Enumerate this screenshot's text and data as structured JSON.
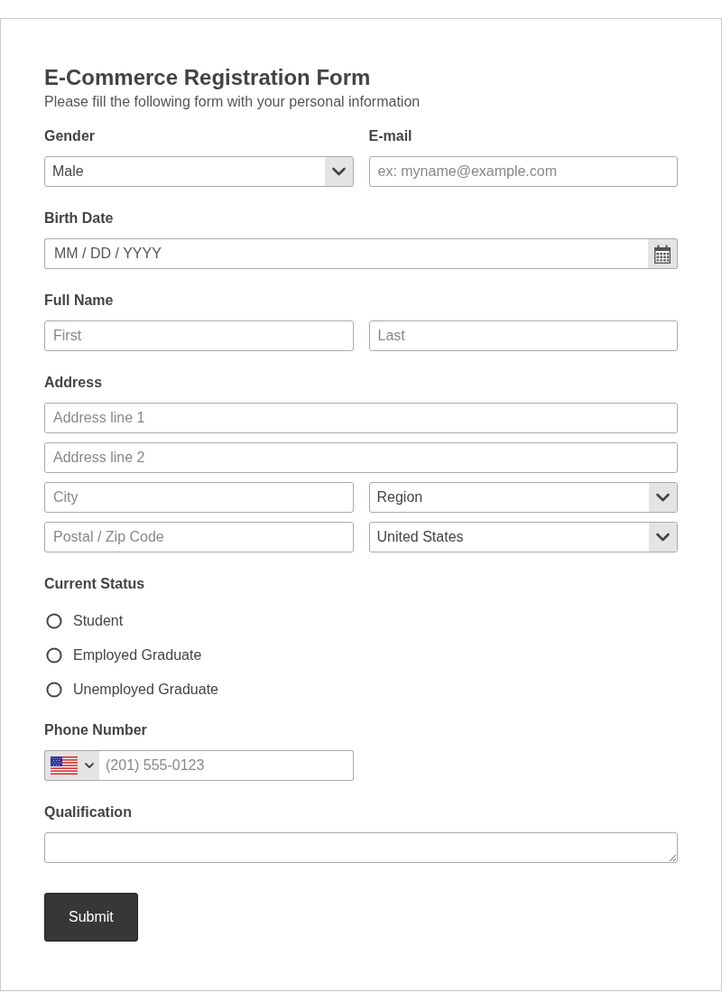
{
  "form": {
    "title": "E-Commerce Registration Form",
    "subtitle": "Please fill the following form with your personal information"
  },
  "rows": [
    [
      {
        "label": "Gender",
        "lines": [
          [
            {
              "kind": "select",
              "value": "Male"
            }
          ]
        ]
      },
      {
        "label": "E-mail",
        "lines": [
          [
            {
              "kind": "input",
              "placeholder": "ex: myname@example.com"
            }
          ]
        ]
      }
    ],
    [
      {
        "label": "Birth Date",
        "lines": [
          [
            {
              "kind": "date",
              "placeholder": "MM / DD / YYYY"
            }
          ]
        ]
      }
    ],
    [
      {
        "label": "Full Name",
        "lines": [
          [
            {
              "kind": "input",
              "placeholder": "First"
            },
            {
              "kind": "input",
              "placeholder": "Last"
            }
          ]
        ]
      }
    ],
    [
      {
        "label": "Address",
        "lines": [
          [
            {
              "kind": "input",
              "placeholder": "Address line 1"
            }
          ],
          [
            {
              "kind": "input",
              "placeholder": "Address line 2"
            }
          ],
          [
            {
              "kind": "input",
              "placeholder": "City"
            },
            {
              "kind": "select",
              "value": "Region"
            }
          ],
          [
            {
              "kind": "input",
              "placeholder": "Postal / Zip Code"
            },
            {
              "kind": "select",
              "value": "United States"
            }
          ]
        ]
      }
    ],
    [
      {
        "label": "Current Status",
        "lines": [
          [
            {
              "kind": "radio",
              "options": [
                {
                  "label": "Student",
                  "selected": false
                },
                {
                  "label": "Employed Graduate",
                  "selected": false
                },
                {
                  "label": "Unemployed Graduate",
                  "selected": false
                }
              ]
            }
          ]
        ]
      }
    ],
    [
      {
        "label": "Phone Number",
        "lines": [
          [
            {
              "kind": "phone",
              "placeholder": "(201) 555-0123"
            }
          ]
        ]
      }
    ],
    [
      {
        "label": "Qualification",
        "lines": [
          [
            {
              "kind": "textarea"
            }
          ]
        ]
      }
    ]
  ],
  "submit": {
    "label": "Submit"
  }
}
